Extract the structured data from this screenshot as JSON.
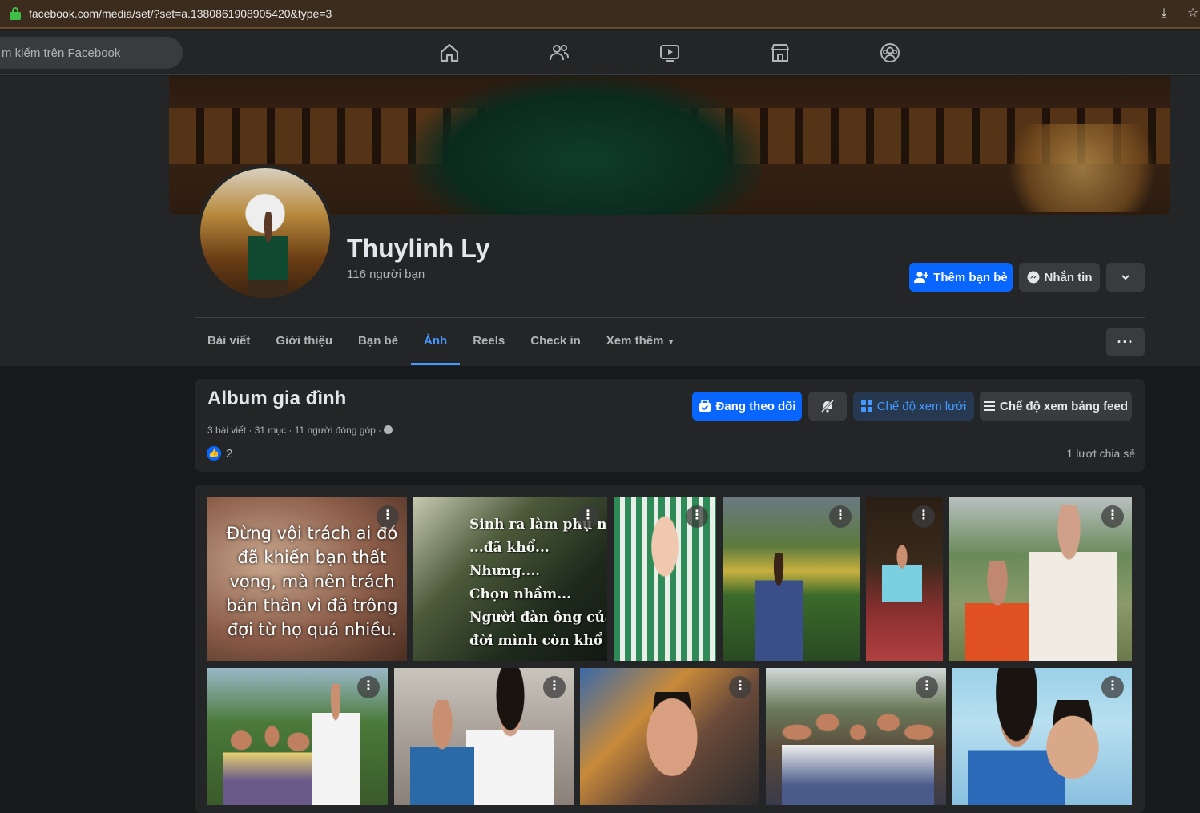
{
  "browser": {
    "url": "facebook.com/media/set/?set=a.1380861908905420&type=3"
  },
  "topnav": {
    "search_placeholder": "m kiếm trên Facebook",
    "icons": [
      "home-icon",
      "friends-icon",
      "video-icon",
      "marketplace-icon",
      "groups-icon"
    ]
  },
  "profile": {
    "name": "Thuylinh Ly",
    "friends_count": "116 người bạn",
    "add_friend_label": "Thêm bạn bè",
    "message_label": "Nhắn tin"
  },
  "tabs": [
    {
      "label": "Bài viết",
      "active": false
    },
    {
      "label": "Giới thiệu",
      "active": false
    },
    {
      "label": "Bạn bè",
      "active": false
    },
    {
      "label": "Ảnh",
      "active": true
    },
    {
      "label": "Reels",
      "active": false
    },
    {
      "label": "Check in",
      "active": false
    },
    {
      "label": "Xem thêm",
      "active": false
    }
  ],
  "album": {
    "title": "Album gia đình",
    "meta": "3 bài viết · 31 mục · 11 người đóng góp ·",
    "likes": "2",
    "shares": "1 lượt chia sẻ",
    "following_label": "Đang theo dõi",
    "grid_view_label": "Chế độ xem lưới",
    "feed_view_label": "Chế độ xem bảng feed"
  },
  "photos": {
    "p1_caption": "Đừng vội trách ai đó\nđã khiến bạn thất\nvọng, mà nên trách\nbản thân vì đã trông\nđợi từ họ quá nhiều.",
    "p2_caption": "Sinh ra làm phụ nữ.\n...đã khổ...\nNhưng....\nChọn nhầm...\nNgười đàn ông của\nđời mình còn khổ hơn"
  },
  "colors": {
    "accent": "#0866ff",
    "active_tab": "#4599ff",
    "surface": "#242526",
    "background": "#18191a"
  }
}
